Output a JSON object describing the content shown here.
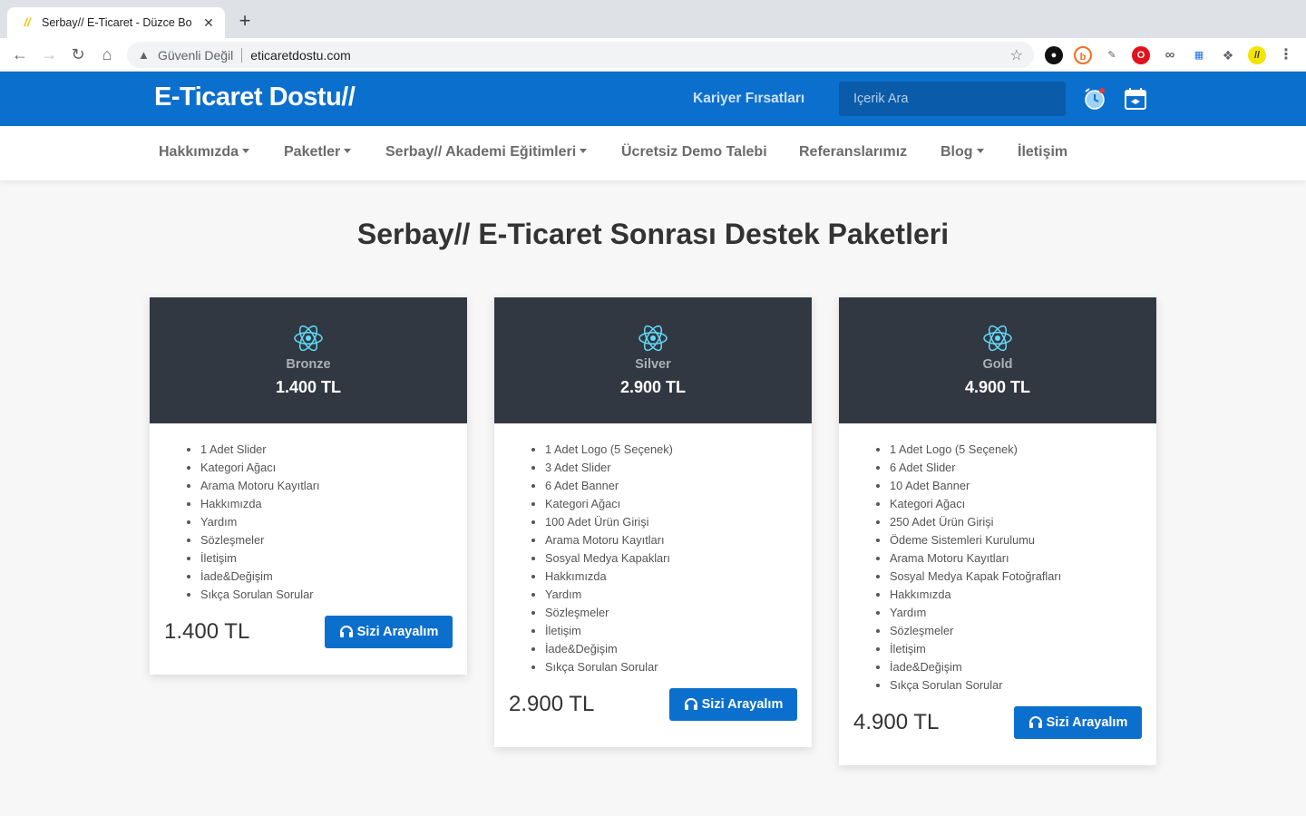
{
  "browser": {
    "tab_title": "Serbay// E-Ticaret - Düzce Bo",
    "favicon_text": "//",
    "new_tab": "+",
    "close": "✕",
    "security_label": "Güvenli Değil",
    "url": "eticaretdostu.com"
  },
  "header": {
    "logo": "E-Ticaret Dostu//",
    "career_link": "Kariyer Fırsatları",
    "search_placeholder": "İçerik Ara"
  },
  "nav": {
    "items": [
      {
        "label": "Hakkımızda",
        "dropdown": true
      },
      {
        "label": "Paketler",
        "dropdown": true
      },
      {
        "label": "Serbay// Akademi Eğitimleri",
        "dropdown": true
      },
      {
        "label": "Ücretsiz Demo Talebi",
        "dropdown": false
      },
      {
        "label": "Referanslarımız",
        "dropdown": false
      },
      {
        "label": "Blog",
        "dropdown": true
      },
      {
        "label": "İletişim",
        "dropdown": false
      }
    ]
  },
  "page": {
    "title": "Serbay// E-Ticaret Sonrası Destek Paketleri"
  },
  "packages": [
    {
      "name": "Bronze",
      "price": "1.400 TL",
      "features": [
        "1 Adet Slider",
        "Kategori Ağacı",
        "Arama Motoru Kayıtları",
        "Hakkımızda",
        "Yardım",
        "Sözleşmeler",
        "İletişim",
        "İade&Değişim",
        "Sıkça Sorulan Sorular"
      ],
      "button": "Sizi Arayalım"
    },
    {
      "name": "Silver",
      "price": "2.900 TL",
      "features": [
        "1 Adet Logo (5 Seçenek)",
        "3 Adet Slider",
        "6 Adet Banner",
        "Kategori Ağacı",
        "100 Adet Ürün Girişi",
        "Arama Motoru Kayıtları",
        "Sosyal Medya Kapakları",
        "Hakkımızda",
        "Yardım",
        "Sözleşmeler",
        "İletişim",
        "İade&Değişim",
        "Sıkça Sorulan Sorular"
      ],
      "button": "Sizi Arayalım"
    },
    {
      "name": "Gold",
      "price": "4.900 TL",
      "features": [
        "1 Adet Logo (5 Seçenek)",
        "6 Adet Slider",
        "10 Adet Banner",
        "Kategori Ağacı",
        "250 Adet Ürün Girişi",
        "Ödeme Sistemleri Kurulumu",
        "Arama Motoru Kayıtları",
        "Sosyal Medya Kapak Fotoğrafları",
        "Hakkımızda",
        "Yardım",
        "Sözleşmeler",
        "İletişim",
        "İade&Değişim",
        "Sıkça Sorulan Sorular"
      ],
      "button": "Sizi Arayalım"
    }
  ],
  "colors": {
    "brand_blue": "#0b6fce",
    "card_header": "#323841",
    "react_cyan": "#61dafb"
  }
}
